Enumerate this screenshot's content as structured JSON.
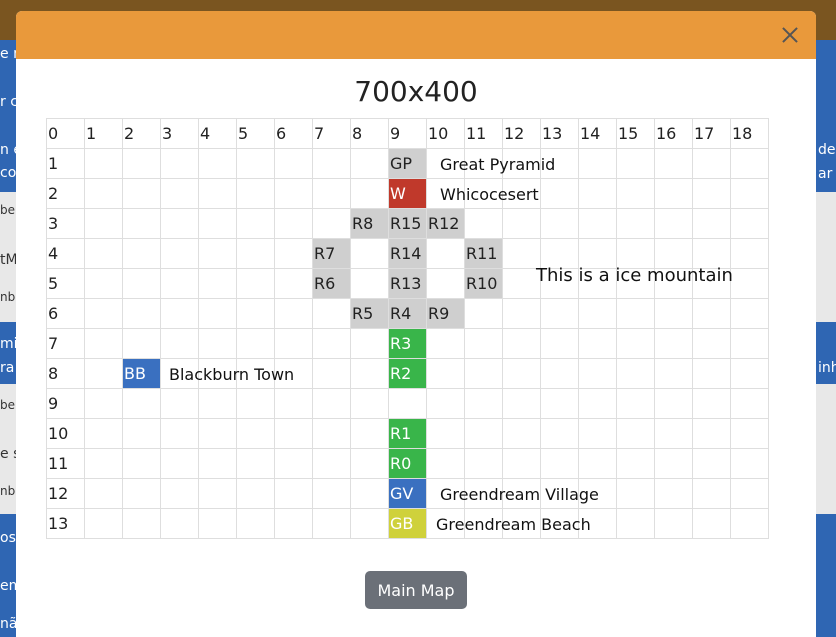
{
  "modal": {
    "title": "700x400",
    "close_icon": "close-icon",
    "main_map_button": "Main Map"
  },
  "grid": {
    "columns": [
      "0",
      "1",
      "2",
      "3",
      "4",
      "5",
      "6",
      "7",
      "8",
      "9",
      "10",
      "11",
      "12",
      "13",
      "14",
      "15",
      "16",
      "17",
      "18"
    ],
    "rows": [
      "1",
      "2",
      "3",
      "4",
      "5",
      "6",
      "7",
      "8",
      "9",
      "10",
      "11",
      "12",
      "13"
    ],
    "cells": [
      {
        "row": 1,
        "col": 9,
        "code": "GP",
        "type": "road",
        "label": "Great Pyramid"
      },
      {
        "row": 2,
        "col": 9,
        "code": "W",
        "type": "red",
        "label": "Whicocesert"
      },
      {
        "row": 3,
        "col": 8,
        "code": "R8",
        "type": "road"
      },
      {
        "row": 3,
        "col": 9,
        "code": "R15",
        "type": "road"
      },
      {
        "row": 3,
        "col": 10,
        "code": "R12",
        "type": "road"
      },
      {
        "row": 4,
        "col": 7,
        "code": "R7",
        "type": "road"
      },
      {
        "row": 4,
        "col": 9,
        "code": "R14",
        "type": "road"
      },
      {
        "row": 4,
        "col": 11,
        "code": "R11",
        "type": "road"
      },
      {
        "row": 5,
        "col": 7,
        "code": "R6",
        "type": "road"
      },
      {
        "row": 5,
        "col": 9,
        "code": "R13",
        "type": "road"
      },
      {
        "row": 5,
        "col": 11,
        "code": "R10",
        "type": "road"
      },
      {
        "row": 6,
        "col": 8,
        "code": "R5",
        "type": "road"
      },
      {
        "row": 6,
        "col": 9,
        "code": "R4",
        "type": "road"
      },
      {
        "row": 6,
        "col": 10,
        "code": "R9",
        "type": "road"
      },
      {
        "row": 7,
        "col": 9,
        "code": "R3",
        "type": "green"
      },
      {
        "row": 8,
        "col": 2,
        "code": "BB",
        "type": "blue",
        "label": "Blackburn Town"
      },
      {
        "row": 8,
        "col": 9,
        "code": "R2",
        "type": "green"
      },
      {
        "row": 10,
        "col": 9,
        "code": "R1",
        "type": "green"
      },
      {
        "row": 11,
        "col": 9,
        "code": "R0",
        "type": "green"
      },
      {
        "row": 12,
        "col": 9,
        "code": "GV",
        "type": "blue",
        "label": "Greendream Village"
      },
      {
        "row": 13,
        "col": 9,
        "code": "GB",
        "type": "yellow",
        "label": "Greendream Beach"
      }
    ],
    "annotation": "This is a ice mountain"
  },
  "background": {
    "fragments": [
      "e n",
      "r c",
      "n e",
      "co",
      "be",
      "tM",
      "nb",
      "min",
      "ra",
      "be",
      "e s",
      "nb",
      "os",
      "em",
      "não",
      "der",
      "ar",
      "inh"
    ]
  },
  "colors": {
    "header": "#e9993b",
    "road": "#cfcfcf",
    "green": "#39b54a",
    "blue": "#3a70c0",
    "red": "#c0392b",
    "yellow": "#cfd13b",
    "button": "#6b7078"
  }
}
